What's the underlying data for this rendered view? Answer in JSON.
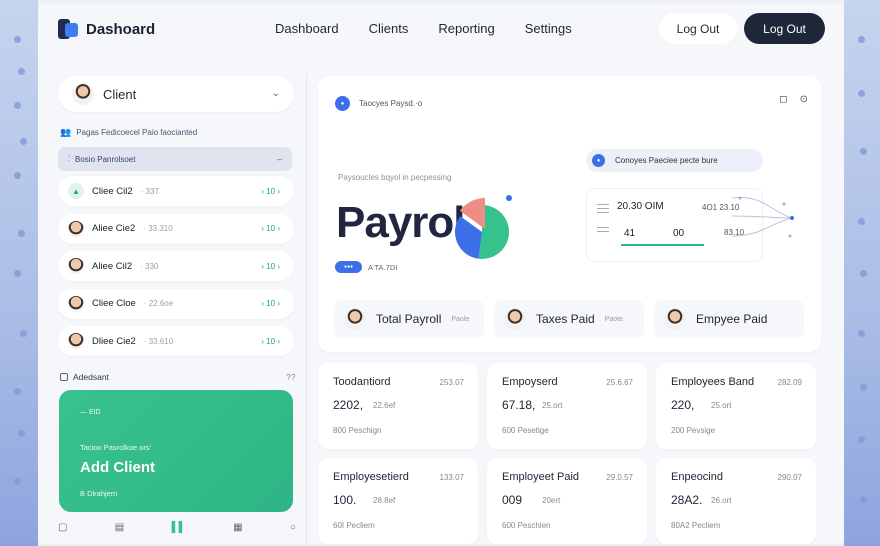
{
  "header": {
    "brand": "Dashoard",
    "nav": [
      "Dashboard",
      "Clients",
      "Reporting",
      "Settings"
    ],
    "logout_ghost": "Log Out",
    "logout_primary": "Log Out"
  },
  "sidebar": {
    "client_select": "Client",
    "section_label": "Pagas Fedicoecel Paio faocianted",
    "filter_label": "Bosio Panrolsoet",
    "clients": [
      {
        "name": "Cliee Cil2",
        "meta": "· 337",
        "count": "› 10 ›"
      },
      {
        "name": "Aliee Cie2",
        "meta": "· 33.310",
        "count": "› 10 ›"
      },
      {
        "name": "Aliee Cil2",
        "meta": "· 330",
        "count": "› 10 ›"
      },
      {
        "name": "Cliee Cloe",
        "meta": "· 22.6oe",
        "count": "› 10 ›"
      },
      {
        "name": "Dliee Cie2",
        "meta": "· 33.610",
        "count": "› 10 ›"
      }
    ],
    "assistant_label": "Adedsant",
    "assistant_more": "??",
    "add_card": {
      "tag": "— EID",
      "subtitle": "Tacioo Pasrolkoe ors'",
      "title": "Add Client",
      "footer": "B Dlrahjem"
    }
  },
  "hero": {
    "chip": "Taocyes Paysd.·o",
    "processing": "Paysoucles bqyol in pecpessing",
    "big_title": "Payrol",
    "badge_label": "A TA.7DI",
    "callout": "Conoyes Paeciee pecte bure",
    "stat_r1a": "20.30 OIM",
    "stat_r1b": "4O1  23.10",
    "stat_r2a": "41",
    "stat_r2b": "00",
    "stat_r2c": "83.10",
    "summary": [
      {
        "label": "Total Payroll",
        "meta": "Paole"
      },
      {
        "label": "Taxes Paid",
        "meta": "Paote"
      },
      {
        "label": "Empyee Paid",
        "meta": ""
      }
    ],
    "pie": {
      "slices": [
        0.52,
        0.33,
        0.15
      ],
      "colors": [
        "#35c28d",
        "#3d6fe8",
        "#f08c86"
      ]
    }
  },
  "cards": [
    {
      "title": "Toodantiord",
      "delta": "253.07",
      "value": "2202,",
      "sub": "22.6ef",
      "foot": "800 Peschign"
    },
    {
      "title": "Empoyserd",
      "delta": "25.6.67",
      "value": "67.18,",
      "sub": "25.ort",
      "foot": "600 Pesetige"
    },
    {
      "title": "Employees Band",
      "delta": "282.09",
      "value": "220,",
      "sub": "25.ort",
      "foot": "200 Pevsige"
    },
    {
      "title": "Employesetierd",
      "delta": "133.07",
      "value": "100.",
      "sub": "28.8ef",
      "foot": "60I Pecliem"
    },
    {
      "title": "Employeet Paid",
      "delta": "29.0.57",
      "value": "009",
      "sub": "20ert",
      "foot": "600 Peschien"
    },
    {
      "title": "Enpeocind",
      "delta": "290.07",
      "value": "28A2.",
      "sub": "26.ort",
      "foot": "80A2 Pecliem"
    }
  ],
  "bottom_bar": [
    "▢",
    "▤",
    "▌▌",
    "▦",
    "○"
  ]
}
